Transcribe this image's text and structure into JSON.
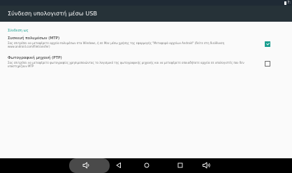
{
  "statusbar": {
    "time": "7:"
  },
  "header": {
    "title": "Σύνδεση υπολογιστή μέσω USB"
  },
  "section": {
    "label": "Σύνδεση ως"
  },
  "options": [
    {
      "title": "Συσκευή πολυμέσων (MTP)",
      "summary": "Σας επιτρέπει να μεταφέρετε αρχεία πολυμέσων στα Windows, ή σε Mac μέσω χρήσης της εφαρμογής \"Μεταφορά αρχείων Android\" (δείτε στη διεύθυνση www.android.com/filetransfer)",
      "checked": true
    },
    {
      "title": "Φωτογραφική μηχανή (PTP)",
      "summary": "Σας επιτρέπει να μεταφέρετε φωτογραφίες χρησιμοποιώντας το λογισμικό της φωτογραφικής μηχανής και να μεταφέρετε οποιαδήποτε αρχεία σε υπολογιστές που δεν υποστηρίζουν MTP",
      "checked": false
    }
  ],
  "navbar": {
    "icons": [
      "volume-down-icon",
      "back-icon",
      "home-icon",
      "recents-icon",
      "volume-up-icon"
    ]
  },
  "colors": {
    "accent": "#1a9e8f",
    "appbar": "#263238",
    "statusbar": "#1f2a35"
  }
}
